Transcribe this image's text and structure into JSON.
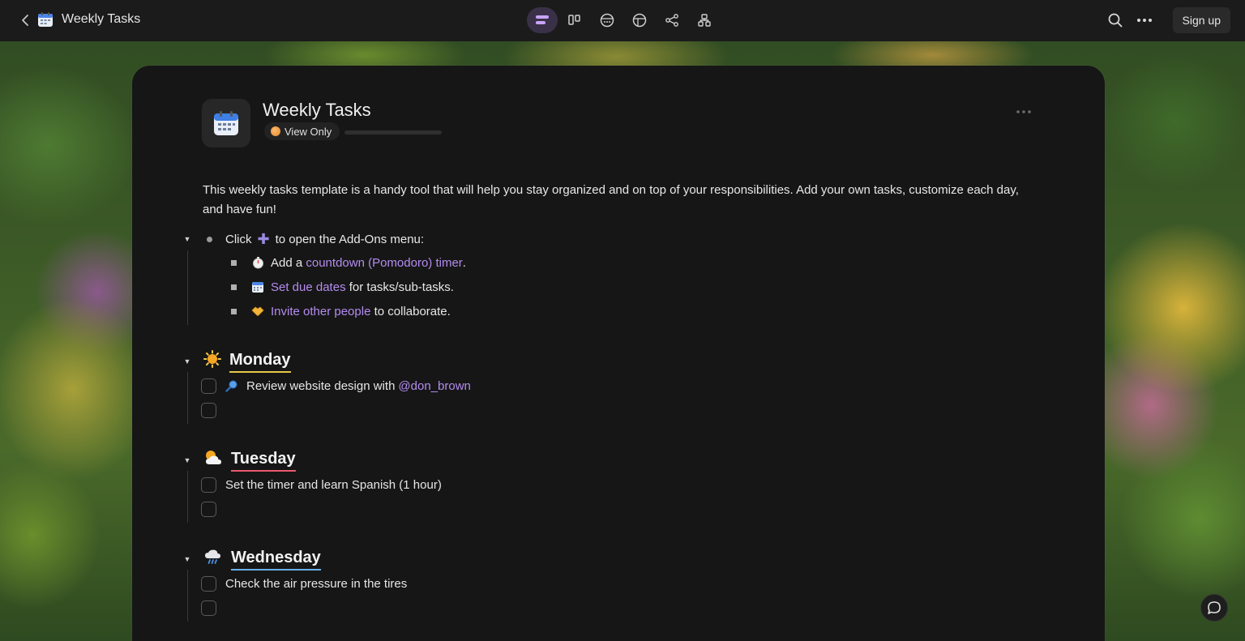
{
  "topbar": {
    "back_icon": "chevron-left-icon",
    "app_icon": "calendar-icon",
    "title": "Weekly Tasks",
    "views": [
      {
        "name": "list-view-icon",
        "active": true
      },
      {
        "name": "board-view-icon",
        "active": false
      },
      {
        "name": "calendar-view-icon",
        "active": false
      },
      {
        "name": "table-view-icon",
        "active": false
      },
      {
        "name": "mindmap-view-icon",
        "active": false
      },
      {
        "name": "org-chart-view-icon",
        "active": false
      }
    ],
    "search_icon": "search-icon",
    "more_icon": "more-horizontal-icon",
    "signup_label": "Sign up",
    "accent": "#b48cf0"
  },
  "doc": {
    "title": "Weekly Tasks",
    "access_badge": "View Only",
    "progress": 0,
    "description": "This weekly tasks template is a handy tool that will help you stay organized and on top of your responsibilities. Add your own tasks, customize each day, and have fun!",
    "addons": {
      "prefix": "Click",
      "suffix": "to open the Add-Ons menu:",
      "items": [
        {
          "icon": "stopwatch-icon",
          "pre": "Add a",
          "link": "countdown (Pomodoro) timer",
          "post": "."
        },
        {
          "icon": "calendar-icon",
          "pre": "",
          "link": "Set due dates",
          "post": "for tasks/sub-tasks."
        },
        {
          "icon": "handshake-icon",
          "pre": "",
          "link": "Invite other people",
          "post": "to collaborate."
        }
      ]
    }
  },
  "days": [
    {
      "name": "Monday",
      "icon": "sun-icon",
      "underline": "#e6c84a",
      "tasks": [
        {
          "icon": "magnifier-icon",
          "text": "Review website design with",
          "mention": "@don_brown"
        },
        {
          "text": ""
        }
      ]
    },
    {
      "name": "Tuesday",
      "icon": "sun-cloud-icon",
      "underline": "#e85a6a",
      "tasks": [
        {
          "text": "Set the timer and learn Spanish (1 hour)"
        },
        {
          "text": ""
        }
      ]
    },
    {
      "name": "Wednesday",
      "icon": "rain-cloud-icon",
      "underline": "#6ab0e6",
      "tasks": [
        {
          "text": "Check the air pressure in the tires"
        },
        {
          "text": ""
        }
      ]
    }
  ],
  "chat_icon": "chat-bubble-icon"
}
